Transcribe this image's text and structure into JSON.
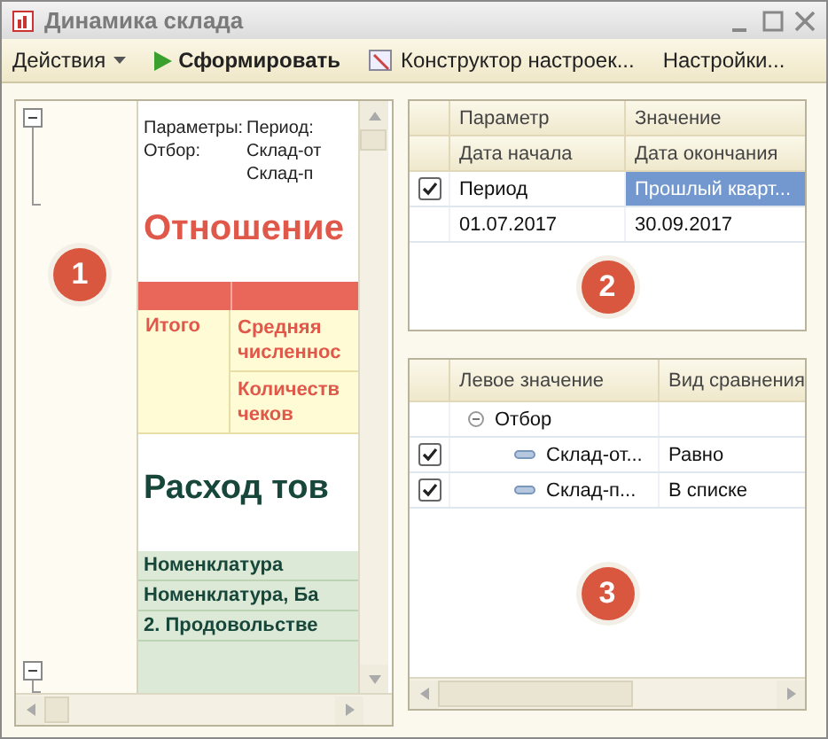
{
  "window": {
    "title": "Динамика склада"
  },
  "toolbar": {
    "actions_menu": "Действия",
    "generate": "Сформировать",
    "designer": "Конструктор настроек...",
    "settings": "Настройки..."
  },
  "report": {
    "badge": "1",
    "params_label": "Параметры:",
    "period_label": "Период:",
    "filter_label": "Отбор:",
    "filter_values": [
      "Склад-от",
      "Склад-п"
    ],
    "title": "Отношение",
    "totals_label": "Итого",
    "measures": [
      "Средняя численнос",
      "Количеств чеков"
    ],
    "section_title": "Расход тов",
    "rows": [
      "Номенклатура",
      "Номенклатура, Ба",
      "2. Продовольстве"
    ]
  },
  "parameters": {
    "badge": "2",
    "columns": [
      "Параметр",
      "Значение"
    ],
    "subcolumns": [
      "Дата начала",
      "Дата окончания"
    ],
    "rows": [
      {
        "enabled": true,
        "name": "Период",
        "value": "Прошлый кварт...",
        "value_selected": true,
        "start": "01.07.2017",
        "end": "30.09.2017"
      }
    ]
  },
  "filter": {
    "badge": "3",
    "columns": [
      "Левое значение",
      "Вид сравнения"
    ],
    "groups": [
      {
        "label": "Отбор",
        "expanded": true,
        "children": [
          {
            "checked": true,
            "label": "Склад-от...",
            "comparison": "Равно"
          },
          {
            "checked": true,
            "label": "Склад-п...",
            "comparison": "В списке"
          }
        ]
      }
    ]
  }
}
